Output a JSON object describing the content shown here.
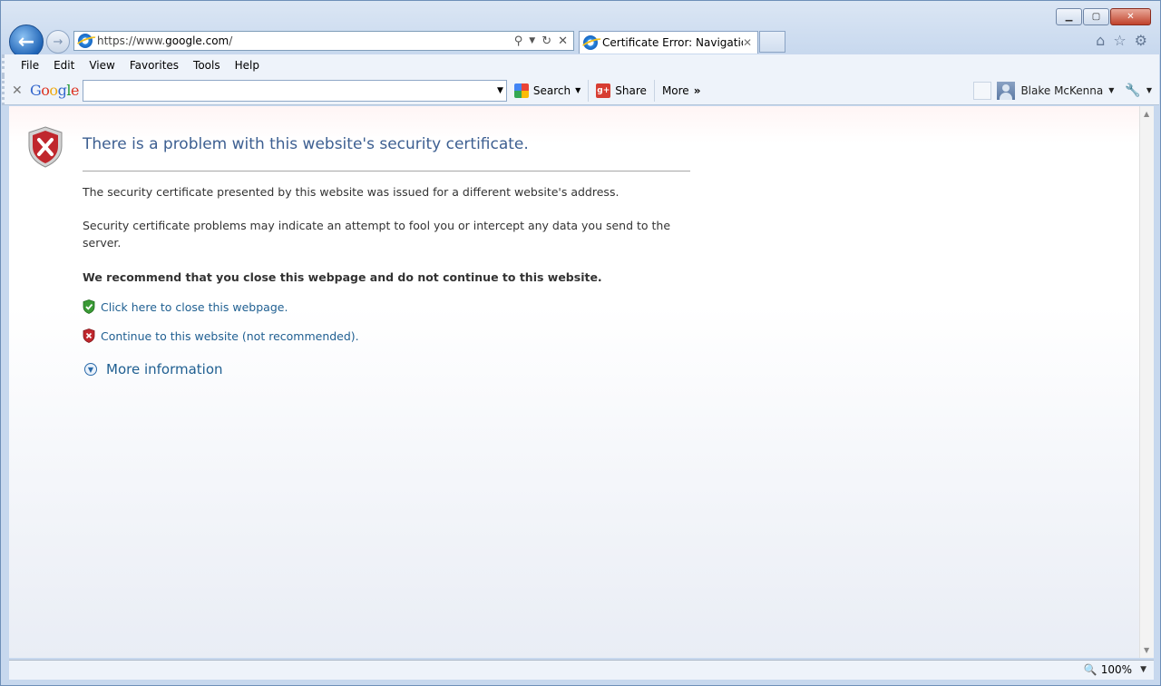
{
  "browser": {
    "address": {
      "prefix": "https://www.",
      "domain": "google.com",
      "suffix": "/"
    },
    "tab_title": "Certificate Error: Navigatio...",
    "menu": [
      "File",
      "Edit",
      "View",
      "Favorites",
      "Tools",
      "Help"
    ],
    "icons": [
      "back-arrow-icon",
      "forward-arrow-icon",
      "ie-logo-icon",
      "search-icon",
      "refresh-icon",
      "stop-icon",
      "home-icon",
      "favorites-star-icon",
      "settings-gear-icon"
    ]
  },
  "google_toolbar": {
    "logo": [
      "G",
      "o",
      "o",
      "g",
      "l",
      "e"
    ],
    "search_label": "Search",
    "share_label": "Share",
    "more_label": "More",
    "more_glyph": "»",
    "user_name": "Blake McKenna"
  },
  "page": {
    "title": "There is a problem with this website's security certificate.",
    "para1": "The security certificate presented by this website was issued for a different website's address.",
    "para2": "Security certificate problems may indicate an attempt to fool you or intercept any data you send to the server.",
    "recommend": "We recommend that you close this webpage and do not continue to this website.",
    "close_link": "Click here to close this webpage.",
    "continue_link": "Continue to this website (not recommended).",
    "more_info": "More information"
  },
  "status_bar": {
    "zoom": "100%"
  },
  "colors": {
    "title_blue": "#3d5f91",
    "link_blue": "#1f5f91",
    "error_red": "#c0272d",
    "safe_green": "#3a9a35"
  }
}
